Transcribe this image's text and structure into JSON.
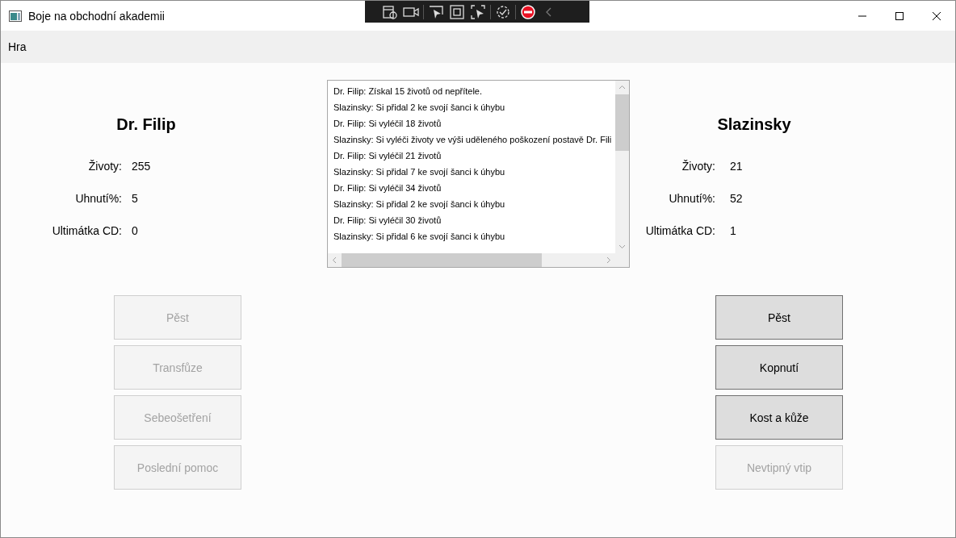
{
  "window": {
    "title": "Boje na obchodní akademii"
  },
  "menu": [
    {
      "label": "Hra"
    }
  ],
  "players": [
    {
      "name": "Dr. Filip",
      "stats": [
        {
          "label": "Životy:",
          "value": "255"
        },
        {
          "label": "Uhnutí%:",
          "value": "5"
        },
        {
          "label": "Ultimátka CD:",
          "value": "0"
        }
      ],
      "actions": [
        {
          "label": "Pěst",
          "disabled": true
        },
        {
          "label": "Transfůze",
          "disabled": true
        },
        {
          "label": "Sebeošetření",
          "disabled": true
        },
        {
          "label": "Poslední pomoc",
          "disabled": true
        }
      ]
    },
    {
      "name": "Slazinsky",
      "stats": [
        {
          "label": "Životy:",
          "value": "21"
        },
        {
          "label": "Uhnutí%:",
          "value": "52"
        },
        {
          "label": "Ultimátka CD:",
          "value": "1"
        }
      ],
      "actions": [
        {
          "label": "Pěst",
          "disabled": false
        },
        {
          "label": "Kopnutí",
          "disabled": false
        },
        {
          "label": "Kost a kůže",
          "disabled": false
        },
        {
          "label": "Nevtipný vtip",
          "disabled": true
        }
      ]
    }
  ],
  "log": {
    "lines": [
      "Dr. Filip: Získal 15 životů od nepřítele.",
      "Slazinsky: Si přidal 2 ke svojí šanci k úhybu",
      "Dr. Filip: Si vyléčil 18 životů",
      "Slazinsky: Si vyléči životy ve výši uděleného poškození postavě Dr. Fili",
      "Dr. Filip: Si vyléčil 21 životů",
      "Slazinsky: Si přidal 7 ke svojí šanci k úhybu",
      "Dr. Filip: Si vyléčil 34 životů",
      "Slazinsky: Si přidal 2 ke svojí šanci k úhybu",
      "Dr. Filip: Si vyléčil 30 životů",
      "Slazinsky: Si přidal 6 ke svojí šanci k úhybu"
    ]
  }
}
